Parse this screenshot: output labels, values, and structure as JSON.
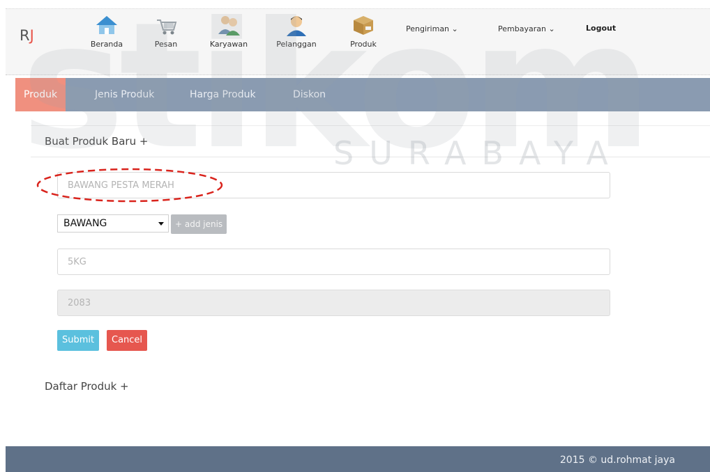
{
  "header": {
    "brand_r": "R",
    "brand_j": "J",
    "nav": [
      {
        "label": "Beranda",
        "icon": "home-icon"
      },
      {
        "label": "Pesan",
        "icon": "cart-icon"
      },
      {
        "label": "Karyawan",
        "icon": "employees-icon"
      },
      {
        "label": "Pelanggan",
        "icon": "customer-icon"
      },
      {
        "label": "Produk",
        "icon": "product-box-icon"
      }
    ],
    "dropdowns": [
      "Pengiriman",
      "Pembayaran"
    ],
    "logout": "Logout"
  },
  "subnav": {
    "tabs": [
      "Produk",
      "Jenis Produk",
      "Harga Produk",
      "Diskon"
    ],
    "active": "Produk"
  },
  "form": {
    "section_title": "Buat Produk Baru +",
    "product_name_placeholder": "BAWANG PESTA MERAH",
    "category_selected": "BAWANG",
    "add_category_label": "+ add jenis",
    "unit_placeholder": "5KG",
    "code_placeholder": "2083",
    "submit_label": "Submit",
    "cancel_label": "Cancel"
  },
  "list": {
    "section_title": "Daftar Produk +"
  },
  "footer": {
    "copyright": "2015 © ud.rohmat jaya"
  },
  "watermark": {
    "big": "stikom",
    "city": "SURABAYA"
  },
  "colors": {
    "subnav_bg": "#8a9bb1",
    "active_tab": "#f0907f",
    "submit": "#5bc0de",
    "cancel": "#e6574f",
    "footer_bg": "#5f7188"
  }
}
